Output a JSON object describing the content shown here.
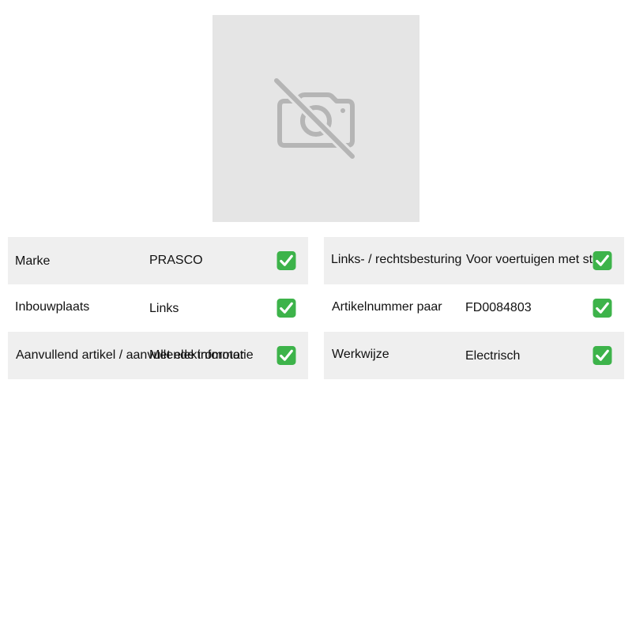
{
  "product_image": {
    "icon": "no-photo-icon",
    "background_color": "#e5e5e5",
    "icon_color": "#b5b5b5"
  },
  "specs_left": [
    {
      "label": "Marke",
      "value": "PRASCO",
      "status_icon": "check-icon"
    },
    {
      "label": "Inbouwplaats",
      "value": "Links",
      "status_icon": "check-icon"
    },
    {
      "label": "Aanvullend artikel / aanvullende informatie",
      "value": "Met elektromotor",
      "status_icon": "check-icon"
    }
  ],
  "specs_right": [
    {
      "label": "Links- / rechtsbesturing",
      "value": "Voor voertuigen met stuur",
      "status_icon": "check-icon"
    },
    {
      "label": "Artikelnummer paar",
      "value": "FD0084803",
      "status_icon": "check-icon"
    },
    {
      "label": "Werkwijze",
      "value": "Electrisch",
      "status_icon": "check-icon"
    }
  ],
  "colors": {
    "row_shaded": "#efefef",
    "check_green": "#3db34a"
  }
}
